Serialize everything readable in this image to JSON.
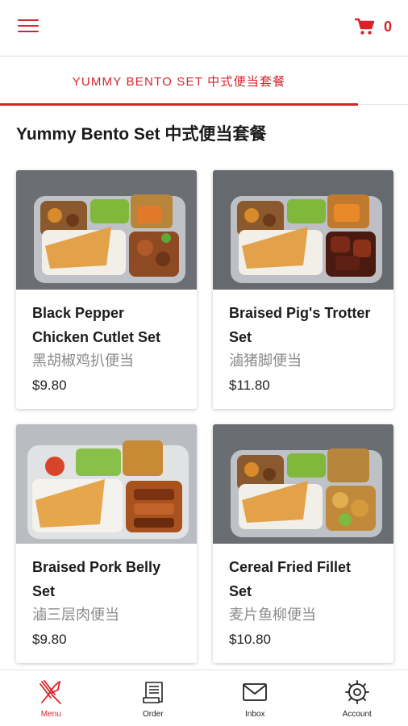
{
  "header": {
    "menu_icon": "hamburger-menu-icon",
    "cart_icon": "shopping-cart-icon",
    "cart_count": "0"
  },
  "tabs": [
    {
      "label": "YUMMY BENTO SET 中式便当套餐",
      "active": true
    }
  ],
  "section": {
    "title": "Yummy Bento Set 中式便当套餐"
  },
  "products": [
    {
      "name_line1": "Black Pepper",
      "name_line2": "Chicken Cutlet Set",
      "chinese": "黑胡椒鸡扒便当",
      "price": "$9.80"
    },
    {
      "name_line1": "Braised Pig's Trotter",
      "name_line2": "Set",
      "chinese": "滷猪脚便当",
      "price": "$11.80"
    },
    {
      "name_line1": "Braised Pork Belly",
      "name_line2": "Set",
      "chinese": "滷三层肉便当",
      "price": "$9.80"
    },
    {
      "name_line1": "Cereal Fried Fillet",
      "name_line2": "Set",
      "chinese": "麦片鱼柳便当",
      "price": "$10.80"
    }
  ],
  "bottom_nav": [
    {
      "label": "Menu",
      "icon": "fork-knife-icon",
      "active": true
    },
    {
      "label": "Order",
      "icon": "receipt-icon",
      "active": false
    },
    {
      "label": "Inbox",
      "icon": "envelope-icon",
      "active": false
    },
    {
      "label": "Account",
      "icon": "gear-icon",
      "active": false
    }
  ],
  "colors": {
    "accent": "#d8232a",
    "muted_text": "#8a8a8a"
  }
}
